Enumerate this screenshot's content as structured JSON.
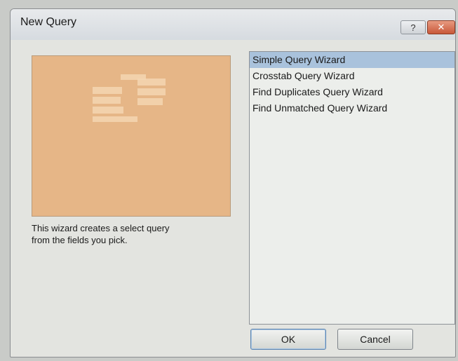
{
  "dialog": {
    "title": "New Query",
    "help_label": "?",
    "close_label": "✕"
  },
  "wizards": [
    {
      "label": "Simple Query Wizard",
      "selected": true
    },
    {
      "label": "Crosstab Query Wizard",
      "selected": false
    },
    {
      "label": "Find Duplicates Query Wizard",
      "selected": false
    },
    {
      "label": "Find Unmatched Query Wizard",
      "selected": false
    }
  ],
  "description": {
    "line1": "This wizard creates a select query",
    "line2": "from the fields you pick."
  },
  "buttons": {
    "ok_label": "OK",
    "cancel_label": "Cancel"
  },
  "colors": {
    "selection": "#a9c2dc",
    "preview": "#e6b687"
  }
}
